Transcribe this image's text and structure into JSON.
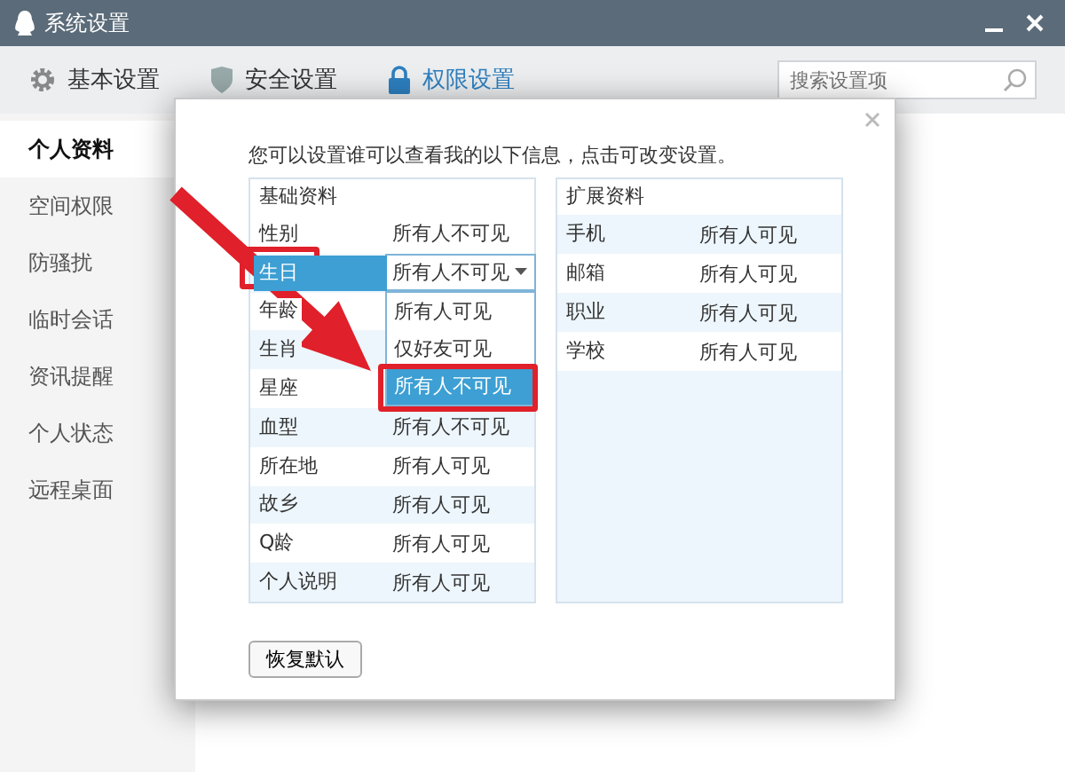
{
  "window": {
    "title": "系统设置"
  },
  "tabs": [
    {
      "label": "基本设置",
      "kind": "gear",
      "selected": false
    },
    {
      "label": "安全设置",
      "kind": "shield",
      "selected": false
    },
    {
      "label": "权限设置",
      "kind": "lock",
      "selected": true
    }
  ],
  "search": {
    "placeholder": "搜索设置项"
  },
  "sidebar": {
    "items": [
      {
        "label": "个人资料",
        "selected": true
      },
      {
        "label": "空间权限",
        "selected": false
      },
      {
        "label": "防骚扰",
        "selected": false
      },
      {
        "label": "临时会话",
        "selected": false
      },
      {
        "label": "资讯提醒",
        "selected": false
      },
      {
        "label": "个人状态",
        "selected": false
      },
      {
        "label": "远程桌面",
        "selected": false
      }
    ]
  },
  "dialog": {
    "intro": "您可以设置谁可以查看我的以下信息，点击可改变设置。",
    "basic": {
      "heading": "基础资料",
      "rows": [
        {
          "label": "性别",
          "value": "所有人不可见",
          "selected": false
        },
        {
          "label": "生日",
          "value": "所有人不可见",
          "selected": true,
          "dropdown": {
            "options": [
              {
                "label": "所有人可见",
                "selected": false
              },
              {
                "label": "仅好友可见",
                "selected": false
              },
              {
                "label": "所有人不可见",
                "selected": true
              }
            ]
          }
        },
        {
          "label": "年龄",
          "selected": false
        },
        {
          "label": "生肖",
          "selected": false
        },
        {
          "label": "星座",
          "selected": false
        },
        {
          "label": "血型",
          "value": "所有人不可见",
          "selected": false
        },
        {
          "label": "所在地",
          "value": "所有人可见",
          "selected": false
        },
        {
          "label": "故乡",
          "value": "所有人可见",
          "selected": false
        },
        {
          "label": "Q龄",
          "value": "所有人可见",
          "selected": false
        },
        {
          "label": "个人说明",
          "value": "所有人可见",
          "selected": false
        }
      ]
    },
    "extended": {
      "heading": "扩展资料",
      "rows": [
        {
          "label": "手机",
          "value": "所有人可见"
        },
        {
          "label": "邮箱",
          "value": "所有人可见"
        },
        {
          "label": "职业",
          "value": "所有人可见"
        },
        {
          "label": "学校",
          "value": "所有人可见"
        }
      ]
    },
    "button": "恢复默认"
  }
}
